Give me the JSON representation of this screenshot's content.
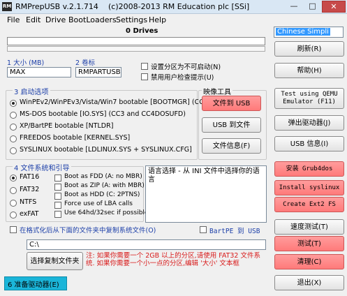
{
  "app": {
    "title": "RMPrepUSB v.2.1.714",
    "copyright": "(c)2008-2013 RM Education plc [SSi]",
    "icon_text": "RM"
  },
  "window_controls": {
    "minimize": "—",
    "maximize": "□",
    "close": "✕"
  },
  "menu": [
    "File",
    "Edit",
    "Drive",
    "BootLoaders",
    "Settings",
    "Help"
  ],
  "drives": {
    "label": "0 Drives"
  },
  "language": {
    "selected": "Chinese Simpli"
  },
  "size_field": {
    "label": "1 大小 (MB)",
    "value": "MAX"
  },
  "volume_field": {
    "label": "2 卷标",
    "value": "RMPARTUSB"
  },
  "options": {
    "no_boot": "设置分区为不可启动(N)",
    "no_prompt": "禁用用户检查提示(U)"
  },
  "boot_group": {
    "label": "3 启动选项",
    "items": [
      "WinPEv2/WinPEv3/Vista/Win7 bootable [BOOTMGR] (CC4)",
      "MS-DOS bootable [IO.SYS]   (CC3 and CC4DOSUFD)",
      "XP/BartPE bootable [NTLDR]",
      "FREEDOS bootable [KERNEL.SYS]",
      "SYSLINUX bootable [LDLINUX.SYS + SYSLINUX.CFG]"
    ]
  },
  "image_tools": {
    "label": "映像工具",
    "file_to_usb": "文件到 USB",
    "usb_to_file": "USB 到文件",
    "file_info": "文件信息(F)"
  },
  "fs_group": {
    "label": "4 文件系统和引导",
    "fs": [
      "FAT16",
      "FAT32",
      "NTFS",
      "exFAT"
    ],
    "checks": [
      "Boot as FDD (A: no MBR)",
      "Boot as ZIP (A: with MBR)",
      "Boot as HDD (C: 2PTNS)",
      "Force use of LBA calls",
      "Use 64hd/32sec if possible"
    ]
  },
  "info_text": "语言选择 - 从 INI 文件中选择你的语言",
  "copy_option": "在格式化后从下面的文件夹中复制系统文件(O)",
  "bartpe_option": "BartPE 到 USB",
  "path_value": "C:\\",
  "select_folder_button": "选择复制文件夹",
  "note_text": "注: 如果你需要一个 2GB 以上的分区,请使用 FAT32 文件系统. 如果你需要一个小一点的分区,编辑 '大小' 文本框",
  "prepare_button": "6 准备驱动器(E)",
  "right_buttons": {
    "refresh": "刷新(R)",
    "help": "帮助(H)",
    "test_qemu": "Test using QEMU Emulator (F11)",
    "eject": "弹出驱动器(J)",
    "usb_info": "USB 信息(I)",
    "install_grub": "安装 Grub4dos",
    "install_syslinux": "Install syslinux",
    "create_ext2": "Create Ext2 FS",
    "speed_test": "速度测试(T)",
    "test": "测试(T)",
    "clean": "清理(C)",
    "exit": "退出(X)"
  },
  "colors": {
    "accent_red": "#ff7a7a",
    "status_cyan": "#1bb5d9",
    "title_blue": "#1b3ea8"
  }
}
